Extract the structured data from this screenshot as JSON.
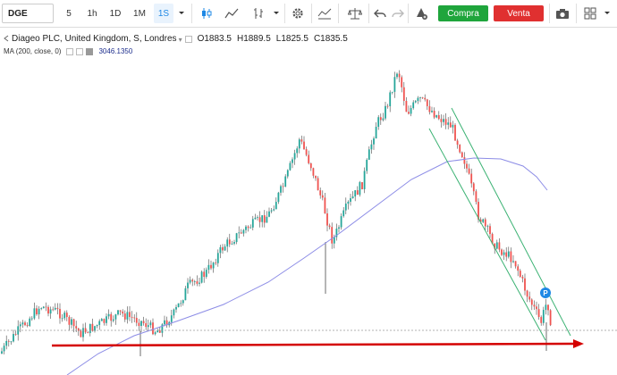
{
  "toolbar": {
    "symbol": "DGE",
    "intervals": [
      "5",
      "1h",
      "1D",
      "1M",
      "1S"
    ],
    "active_interval": "1S",
    "buy_label": "Compra",
    "sell_label": "Venta",
    "icons": [
      "chevron-down-icon",
      "candles-icon",
      "area-chart-icon",
      "bars-icon",
      "chevron-down-icon",
      "gear-icon",
      "indicators-icon",
      "compare-icon",
      "undo-icon",
      "redo-icon",
      "alert-icon",
      "camera-icon",
      "layout-grid-icon",
      "chevron-down-icon"
    ]
  },
  "legend": {
    "title": "Diageo PLC, United Kingdom, S, Londres",
    "o_label": "O",
    "o_value": "1883.5",
    "h_label": "H",
    "h_value": "1889.5",
    "l_label": "L",
    "l_value": "1825.5",
    "c_label": "C",
    "c_value": "1835.5",
    "ma_label": "MA (200, close, 0)",
    "ma_value": "3046.1350"
  },
  "marker_label": "P",
  "colors": {
    "up": "#26a69a",
    "down": "#ef5350",
    "ma_line": "#8c8ce6",
    "channel": "#3bb273",
    "support_arrow": "#d40000",
    "buy": "#1fa53c",
    "sell": "#e03030",
    "marker": "#1e88e5"
  }
}
